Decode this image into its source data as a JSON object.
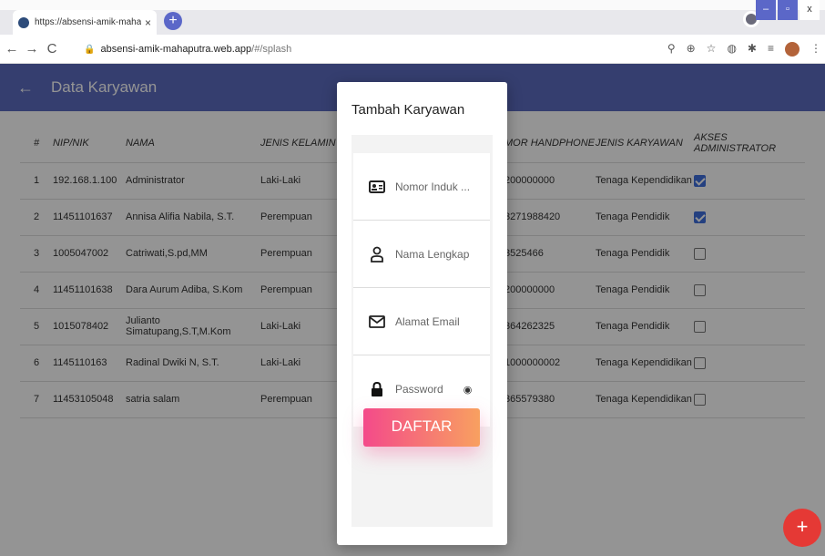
{
  "browser": {
    "tab_title": "https://absensi-amik-mahaputra",
    "tab_close": "×",
    "new_tab": "+",
    "url_host": "absensi-amik-mahaputra.web.app",
    "url_path": "/#/splash",
    "window_controls": [
      "–",
      "▫",
      "x"
    ]
  },
  "appbar": {
    "back_icon": "←",
    "title": "Data Karyawan"
  },
  "table": {
    "headers": [
      "#",
      "NIP/NIK",
      "NAMA",
      "JENIS KELAMIN",
      "MOR HANDPHONE",
      "JENIS KARYAWAN",
      "AKSES ADMINISTRATOR"
    ],
    "rows": [
      {
        "no": "1",
        "nip": "192.168.1.100",
        "nama": "Administrator",
        "jk": "Laki-Laki",
        "hp": "200000000",
        "jenis": "Tenaga Kependidikan",
        "admin": true
      },
      {
        "no": "2",
        "nip": "11451101637",
        "nama": "Annisa Alifia Nabila, S.T.",
        "jk": "Perempuan",
        "hp": "3271988420",
        "jenis": "Tenaga Pendidik",
        "admin": true
      },
      {
        "no": "3",
        "nip": "1005047002",
        "nama": "Catriwati,S.pd,MM",
        "jk": "Perempuan",
        "hp": "3525466",
        "jenis": "Tenaga Pendidik",
        "admin": false
      },
      {
        "no": "4",
        "nip": "11451101638",
        "nama": "Dara Aurum Adiba, S.Kom",
        "jk": "Perempuan",
        "hp": "200000000",
        "jenis": "Tenaga Pendidik",
        "admin": false
      },
      {
        "no": "5",
        "nip": "1015078402",
        "nama": "Julianto Simatupang,S.T,M.Kom",
        "jk": "Laki-Laki",
        "hp": "364262325",
        "jenis": "Tenaga Pendidik",
        "admin": false
      },
      {
        "no": "6",
        "nip": "1145110163",
        "nama": "Radinal Dwiki N, S.T.",
        "jk": "Laki-Laki",
        "hp": "1000000002",
        "jenis": "Tenaga Kependidikan",
        "admin": false
      },
      {
        "no": "7",
        "nip": "11453105048",
        "nama": "satria salam",
        "jk": "Perempuan",
        "hp": "365579380",
        "jenis": "Tenaga Kependidikan",
        "admin": false
      }
    ]
  },
  "dialog": {
    "title": "Tambah Karyawan",
    "fields": {
      "nomor_induk": "Nomor Induk ...",
      "nama": "Nama Lengkap",
      "email": "Alamat Email",
      "password": "Password"
    },
    "submit_label": "DAFTAR"
  },
  "fab_label": "+"
}
